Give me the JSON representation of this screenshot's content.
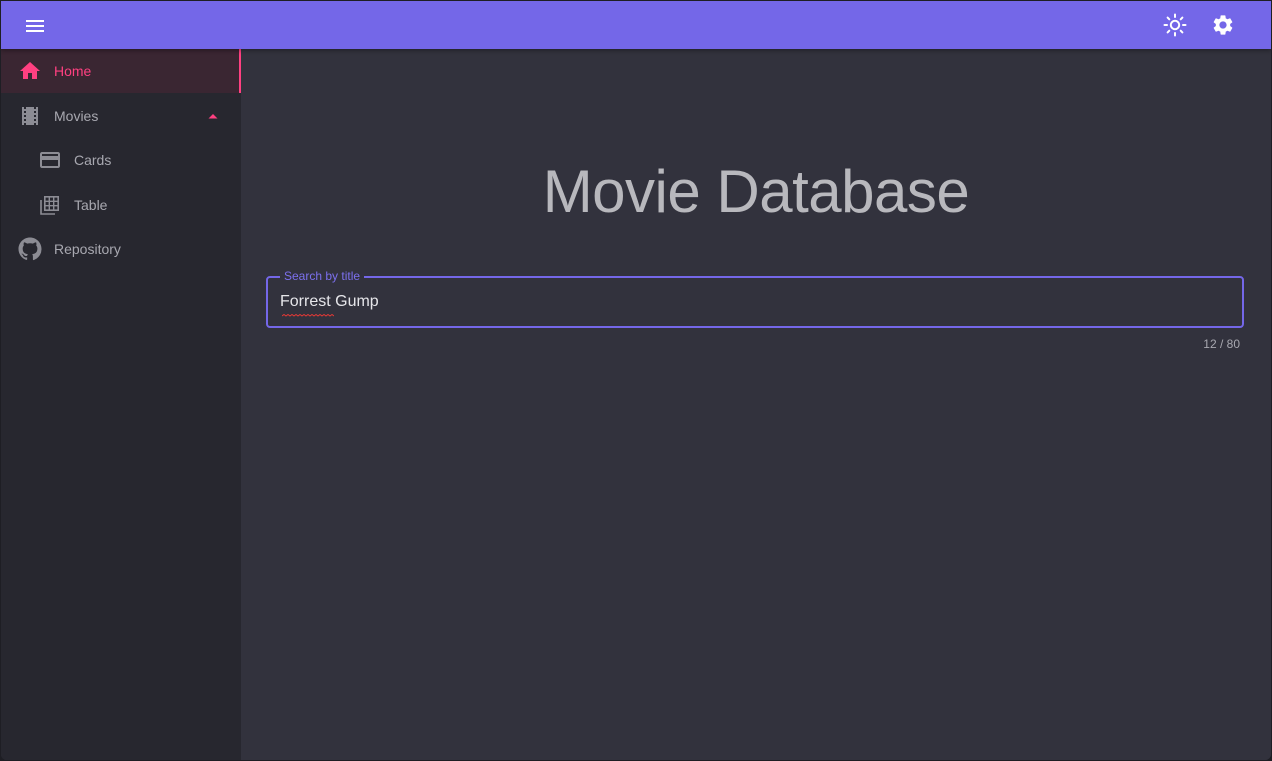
{
  "colors": {
    "primary": "#7467e8",
    "accent": "#ff4081",
    "background": "#32323d",
    "drawer": "#27272f"
  },
  "appbar": {
    "menu_icon": "menu-icon",
    "theme_icon": "brightness-icon",
    "settings_icon": "gear-icon"
  },
  "nav": {
    "home": {
      "label": "Home",
      "icon": "home-icon"
    },
    "movies": {
      "label": "Movies",
      "icon": "film-icon",
      "expanded": true
    },
    "cards": {
      "label": "Cards",
      "icon": "credit-card-icon"
    },
    "table": {
      "label": "Table",
      "icon": "table-icon"
    },
    "repository": {
      "label": "Repository",
      "icon": "github-icon"
    }
  },
  "main": {
    "title": "Movie Database",
    "search": {
      "label": "Search by title",
      "value": "Forrest Gump",
      "counter": "12 / 80"
    }
  }
}
